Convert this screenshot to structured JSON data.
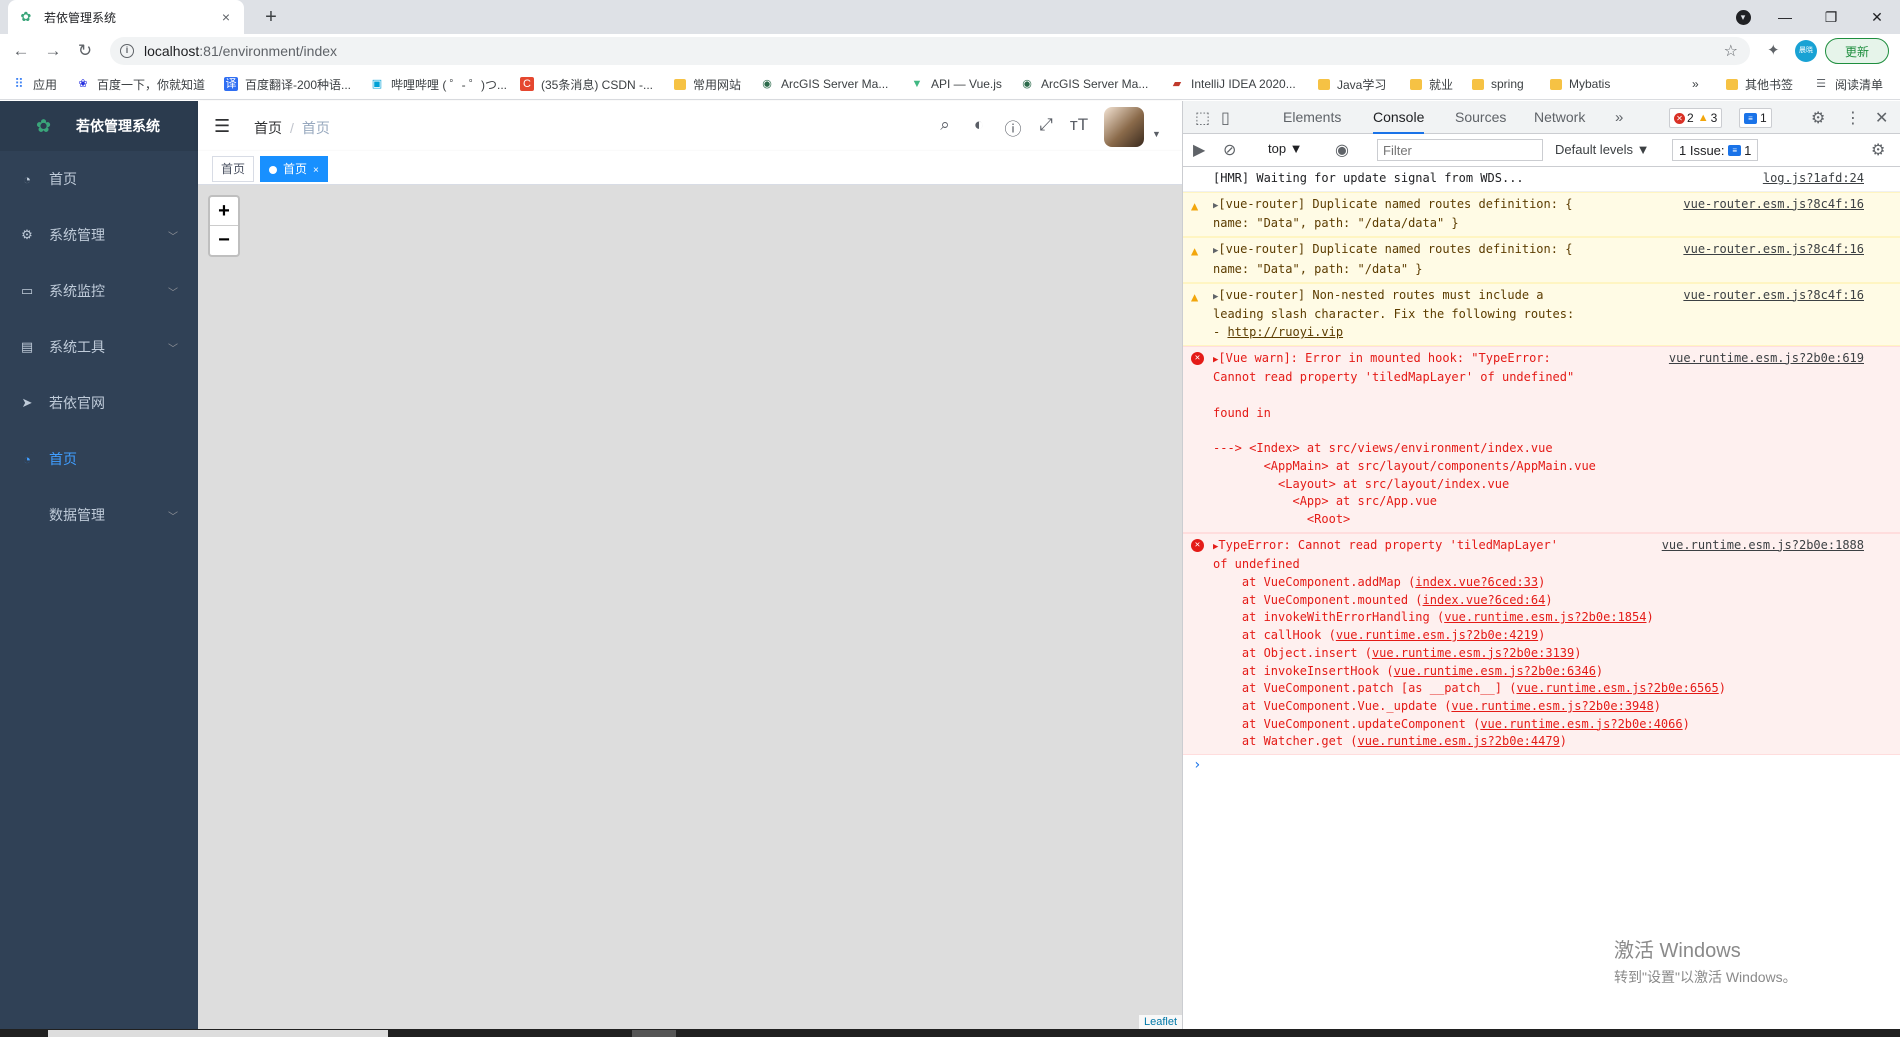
{
  "browser": {
    "tab_title": "若依管理系统",
    "tab_close": "×",
    "new_tab": "+",
    "url_host": "localhost",
    "url_path": ":81/environment/index",
    "update_label": "更新",
    "profile_initial": "晨晓"
  },
  "bookmarks": [
    {
      "label": "应用",
      "icon": "apps-grid-icon"
    },
    {
      "label": "百度一下，你就知道",
      "icon": "baidu-icon"
    },
    {
      "label": "百度翻译-200种语...",
      "icon": "translate-icon"
    },
    {
      "label": "哔哩哔哩 ( ゜- ゜)つ...",
      "icon": "bilibili-icon"
    },
    {
      "label": "(35条消息) CSDN -...",
      "icon": "csdn-icon"
    },
    {
      "label": "常用网站",
      "icon": "folder-icon"
    },
    {
      "label": "ArcGIS Server Ma...",
      "icon": "globe-icon"
    },
    {
      "label": "API — Vue.js",
      "icon": "vue-icon"
    },
    {
      "label": "ArcGIS Server Ma...",
      "icon": "globe-icon"
    },
    {
      "label": "IntelliJ IDEA 2020...",
      "icon": "jetbrains-icon"
    },
    {
      "label": "Java学习",
      "icon": "folder-icon"
    },
    {
      "label": "就业",
      "icon": "folder-icon"
    },
    {
      "label": "spring",
      "icon": "folder-icon"
    },
    {
      "label": "Mybatis",
      "icon": "folder-icon"
    },
    {
      "label": "»",
      "icon": ""
    },
    {
      "label": "其他书签",
      "icon": "folder-icon"
    },
    {
      "label": "阅读清单",
      "icon": "reading-list-icon"
    }
  ],
  "app": {
    "title": "若依管理系统",
    "menu": [
      {
        "label": "首页",
        "icon": "dashboard-icon",
        "has_children": false,
        "active": false
      },
      {
        "label": "系统管理",
        "icon": "gear-icon",
        "has_children": true,
        "active": false
      },
      {
        "label": "系统监控",
        "icon": "monitor-icon",
        "has_children": true,
        "active": false
      },
      {
        "label": "系统工具",
        "icon": "toolbox-icon",
        "has_children": true,
        "active": false
      },
      {
        "label": "若依官网",
        "icon": "send-icon",
        "has_children": false,
        "active": false
      },
      {
        "label": "首页",
        "icon": "dashboard-icon",
        "has_children": false,
        "active": true
      },
      {
        "label": "数据管理",
        "icon": "",
        "has_children": true,
        "active": false
      }
    ],
    "breadcrumb": [
      "首页",
      "首页"
    ],
    "breadcrumb_sep": "/",
    "tags": [
      {
        "label": "首页",
        "active": false
      },
      {
        "label": "首页",
        "active": true,
        "close": "×"
      }
    ],
    "map": {
      "zoom_in": "+",
      "zoom_out": "−",
      "attribution": "Leaflet"
    }
  },
  "devtools": {
    "tabs": [
      "Elements",
      "Console",
      "Sources",
      "Network"
    ],
    "active_tab": "Console",
    "more_tabs": "»",
    "error_count": "2",
    "warning_count": "3",
    "message_count": "1",
    "context": "top ▼",
    "filter_placeholder": "Filter",
    "levels": "Default levels ▼",
    "issues_label": "1 Issue:",
    "issues_count": "1",
    "messages": [
      {
        "level": "info",
        "text": "[HMR] Waiting for update signal from WDS...",
        "source": "log.js?1afd:24"
      },
      {
        "level": "warn",
        "text": "[vue-router] Duplicate named routes definition: {\nname: \"Data\", path: \"/data/data\" }",
        "source": "vue-router.esm.js?8c4f:16"
      },
      {
        "level": "warn",
        "text": "[vue-router] Duplicate named routes definition: {\nname: \"Data\", path: \"/data\" }",
        "source": "vue-router.esm.js?8c4f:16"
      },
      {
        "level": "warn",
        "text": "[vue-router] Non-nested routes must include a\nleading slash character. Fix the following routes:\n- ",
        "link": "http://ruoyi.vip",
        "source": "vue-router.esm.js?8c4f:16"
      },
      {
        "level": "error",
        "text": "[Vue warn]: Error in mounted hook: \"TypeError:\nCannot read property 'tiledMapLayer' of undefined\"\n\nfound in\n\n---> <Index> at src/views/environment/index.vue\n       <AppMain> at src/layout/components/AppMain.vue\n         <Layout> at src/layout/index.vue\n           <App> at src/App.vue\n             <Root>",
        "source": "vue.runtime.esm.js?2b0e:619"
      },
      {
        "level": "error",
        "text": "TypeError: Cannot read property 'tiledMapLayer'\nof undefined",
        "source": "vue.runtime.esm.js?2b0e:1888",
        "stack": [
          {
            "fn": "    at VueComponent.addMap (",
            "loc": "index.vue?6ced:33",
            "end": ")"
          },
          {
            "fn": "    at VueComponent.mounted (",
            "loc": "index.vue?6ced:64",
            "end": ")"
          },
          {
            "fn": "    at invokeWithErrorHandling (",
            "loc": "vue.runtime.esm.js?2b0e:1854",
            "end": ")"
          },
          {
            "fn": "    at callHook (",
            "loc": "vue.runtime.esm.js?2b0e:4219",
            "end": ")"
          },
          {
            "fn": "    at Object.insert (",
            "loc": "vue.runtime.esm.js?2b0e:3139",
            "end": ")"
          },
          {
            "fn": "    at invokeInsertHook (",
            "loc": "vue.runtime.esm.js?2b0e:6346",
            "end": ")"
          },
          {
            "fn": "    at VueComponent.patch [as __patch__] (",
            "loc": "vue.runtime.esm.js?2b0e:6565",
            "end": ")"
          },
          {
            "fn": "    at VueComponent.Vue._update (",
            "loc": "vue.runtime.esm.js?2b0e:3948",
            "end": ")"
          },
          {
            "fn": "    at VueComponent.updateComponent (",
            "loc": "vue.runtime.esm.js?2b0e:4066",
            "end": ")"
          },
          {
            "fn": "    at Watcher.get (",
            "loc": "vue.runtime.esm.js?2b0e:4479",
            "end": ")"
          }
        ]
      }
    ],
    "prompt": "›"
  },
  "watermark": {
    "line1": "激活 Windows",
    "line2": "转到\"设置\"以激活 Windows。"
  },
  "colors": {
    "sidebar_bg": "#304156",
    "active_menu": "#409eff",
    "active_tag": "#1890ff",
    "error": "#e41b17",
    "warning": "#f2a60c"
  }
}
